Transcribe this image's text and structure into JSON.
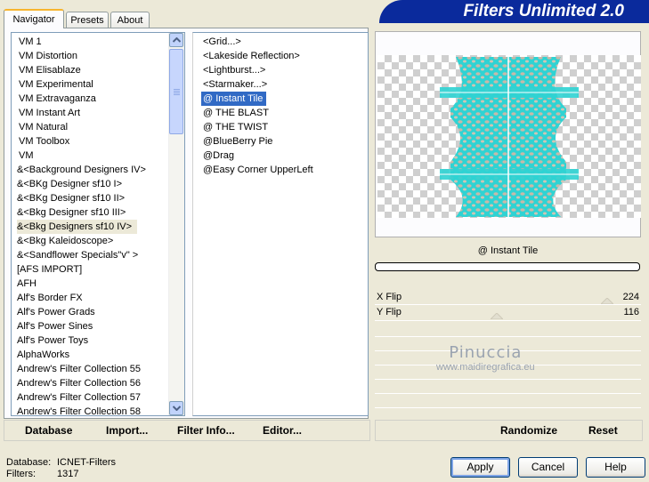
{
  "title": "Filters Unlimited 2.0",
  "tabs": [
    {
      "label": "Navigator"
    },
    {
      "label": "Presets"
    },
    {
      "label": "About"
    }
  ],
  "categories": [
    {
      "label": "VM 1"
    },
    {
      "label": "VM Distortion"
    },
    {
      "label": "VM Elisablaze"
    },
    {
      "label": "VM Experimental"
    },
    {
      "label": "VM Extravaganza"
    },
    {
      "label": "VM Instant Art"
    },
    {
      "label": "VM Natural"
    },
    {
      "label": "VM Toolbox"
    },
    {
      "label": "VM"
    },
    {
      "label": "&<Background Designers IV>"
    },
    {
      "label": "&<BKg Designer sf10 I>"
    },
    {
      "label": "&<BKg Designer sf10 II>"
    },
    {
      "label": "&<Bkg Designer sf10 III>"
    },
    {
      "label": "&<Bkg Designers sf10 IV>"
    },
    {
      "label": "&<Bkg Kaleidoscope>"
    },
    {
      "label": "&<Sandflower Specials\"v\" >"
    },
    {
      "label": "[AFS IMPORT]"
    },
    {
      "label": "AFH"
    },
    {
      "label": "Alf's Border FX"
    },
    {
      "label": "Alf's Power Grads"
    },
    {
      "label": "Alf's Power Sines"
    },
    {
      "label": "Alf's Power Toys"
    },
    {
      "label": "AlphaWorks"
    },
    {
      "label": "Andrew's Filter Collection 55"
    },
    {
      "label": "Andrew's Filter Collection 56"
    },
    {
      "label": "Andrew's Filter Collection 57"
    },
    {
      "label": "Andrew's Filter Collection 58"
    }
  ],
  "filters": [
    {
      "label": "<Grid...>"
    },
    {
      "label": "<Lakeside Reflection>"
    },
    {
      "label": "<Lightburst...>"
    },
    {
      "label": "<Starmaker...>"
    },
    {
      "label": "@ Instant Tile"
    },
    {
      "label": "@ THE BLAST"
    },
    {
      "label": "@ THE TWIST"
    },
    {
      "label": "@BlueBerry Pie"
    },
    {
      "label": "@Drag"
    },
    {
      "label": "@Easy Corner UpperLeft"
    }
  ],
  "selected_filter": "@ Instant Tile",
  "params": [
    {
      "label": "X Flip",
      "value": "224"
    },
    {
      "label": "Y Flip",
      "value": "116"
    }
  ],
  "watermark": {
    "name": "Pinuccia",
    "url": "www.maidiregrafica.eu"
  },
  "left_buttons": {
    "database": "Database",
    "import": "Import...",
    "filter_info": "Filter Info...",
    "editor": "Editor..."
  },
  "right_buttons": {
    "randomize": "Randomize",
    "reset": "Reset"
  },
  "status": {
    "database_label": "Database:",
    "database_value": "ICNET-Filters",
    "filters_label": "Filters:",
    "filters_value": "1317"
  },
  "dialog_buttons": {
    "apply": "Apply",
    "cancel": "Cancel",
    "help": "Help"
  },
  "colors": {
    "selection": "#316ac5",
    "banner": "#0a2a9c",
    "preview_tile": "#2fd3d3"
  },
  "icons": {
    "scroll_up": "chevron-up-icon",
    "scroll_down": "chevron-down-icon"
  }
}
